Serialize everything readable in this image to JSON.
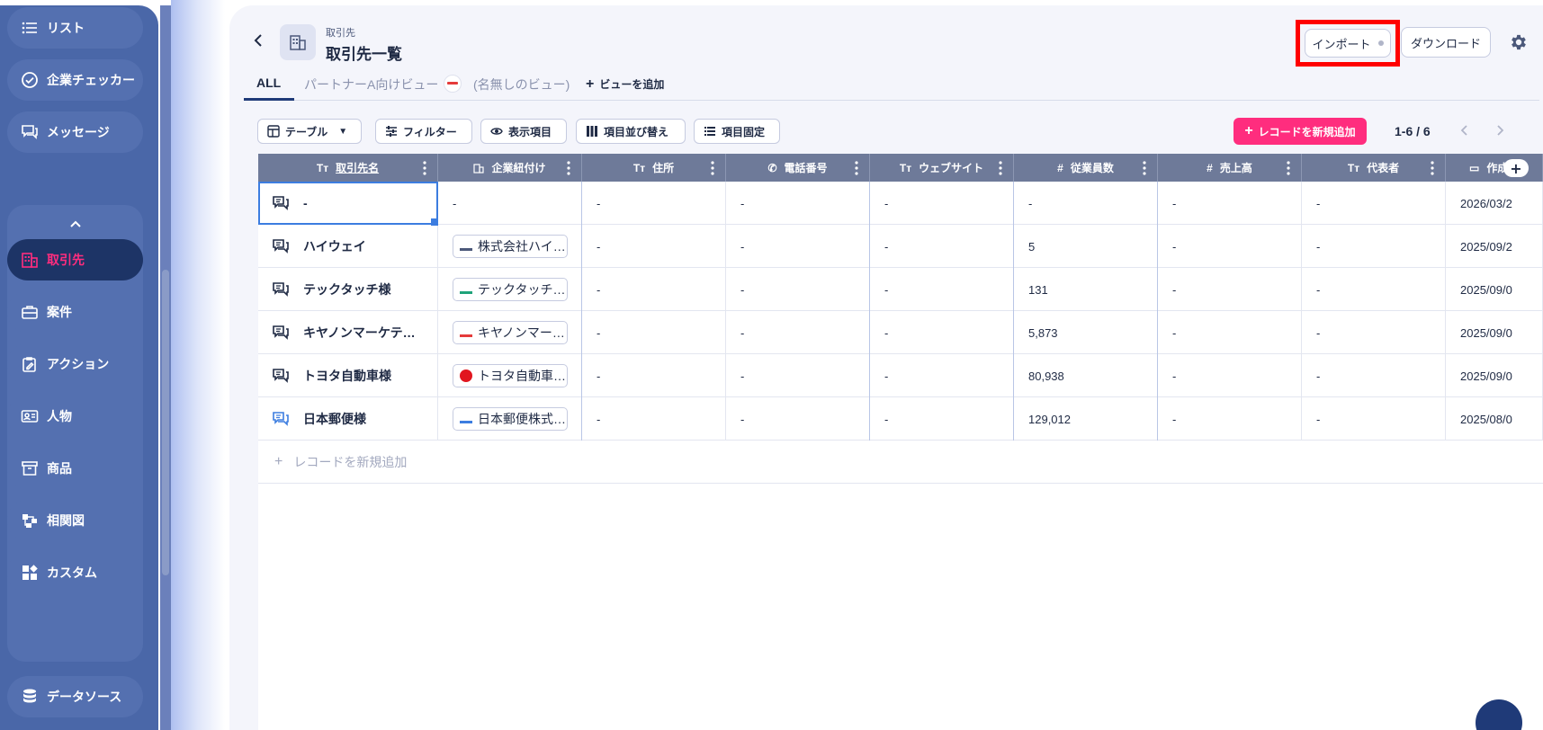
{
  "sidebar": {
    "items": [
      {
        "id": "list",
        "label": "リスト"
      },
      {
        "id": "company-checker",
        "label": "企業チェッカー"
      },
      {
        "id": "messages",
        "label": "メッセージ"
      },
      {
        "id": "accounts",
        "label": "取引先"
      },
      {
        "id": "deals",
        "label": "案件"
      },
      {
        "id": "actions",
        "label": "アクション"
      },
      {
        "id": "people",
        "label": "人物"
      },
      {
        "id": "products",
        "label": "商品"
      },
      {
        "id": "relationship",
        "label": "相関図"
      },
      {
        "id": "custom",
        "label": "カスタム"
      },
      {
        "id": "datasource",
        "label": "データソース"
      }
    ],
    "active": "取引先"
  },
  "header": {
    "breadcrumb": "取引先",
    "title": "取引先一覧",
    "import_label": "インポート",
    "download_label": "ダウンロード"
  },
  "tabs": [
    {
      "label": "ALL"
    },
    {
      "label": "パートナーA向けビュー"
    },
    {
      "label": "(名無しのビュー)"
    },
    {
      "label": "ビューを追加"
    }
  ],
  "toolbar": {
    "view_type": "テーブル",
    "filter": "フィルター",
    "display_fields": "表示項目",
    "reorder_fields": "項目並び替え",
    "pin_fields": "項目固定",
    "add_record": "レコードを新規追加",
    "pager": "1-6 / 6"
  },
  "table": {
    "columns": [
      {
        "label": "取引先名",
        "icon": "Tт"
      },
      {
        "label": "企業紐付け",
        "icon": "building"
      },
      {
        "label": "住所",
        "icon": "Tт"
      },
      {
        "label": "電話番号",
        "icon": "phone"
      },
      {
        "label": "ウェブサイト",
        "icon": "Tт"
      },
      {
        "label": "従業員数",
        "icon": "#"
      },
      {
        "label": "売上高",
        "icon": "#"
      },
      {
        "label": "代表者",
        "icon": "Tт"
      },
      {
        "label": "作成日",
        "icon": "calendar"
      }
    ],
    "rows": [
      {
        "name": "-",
        "company": "-",
        "address": "-",
        "phone": "-",
        "website": "-",
        "employees": "-",
        "revenue": "-",
        "rep": "-",
        "date": "2026/03/2"
      },
      {
        "name": "ハイウェイ",
        "company": "株式会社ハイウェイ",
        "address": "-",
        "phone": "-",
        "website": "-",
        "employees": "5",
        "revenue": "-",
        "rep": "-",
        "date": "2025/09/2"
      },
      {
        "name": "テックタッチ様",
        "company": "テックタッチ株式会社",
        "address": "-",
        "phone": "-",
        "website": "-",
        "employees": "131",
        "revenue": "-",
        "rep": "-",
        "date": "2025/09/0"
      },
      {
        "name": "キヤノンマーケテ…",
        "company": "キヤノンマーケティング",
        "address": "-",
        "phone": "-",
        "website": "-",
        "employees": "5,873",
        "revenue": "-",
        "rep": "-",
        "date": "2025/09/0"
      },
      {
        "name": "トヨタ自動車様",
        "company": "トヨタ自動車株式会社",
        "address": "-",
        "phone": "-",
        "website": "-",
        "employees": "80,938",
        "revenue": "-",
        "rep": "-",
        "date": "2025/09/0"
      },
      {
        "name": "日本郵便様",
        "company": "日本郵便株式会社",
        "address": "-",
        "phone": "-",
        "website": "-",
        "employees": "129,012",
        "revenue": "-",
        "rep": "-",
        "date": "2025/08/0"
      }
    ],
    "add_row_label": "レコードを新規追加",
    "add_column": "+"
  },
  "colors": {
    "sidebar": "#4a67a8",
    "active_nav": "#1d3466",
    "accent": "#ff2d7e",
    "header_row": "#6e7a99",
    "highlight": "#ff0000"
  }
}
